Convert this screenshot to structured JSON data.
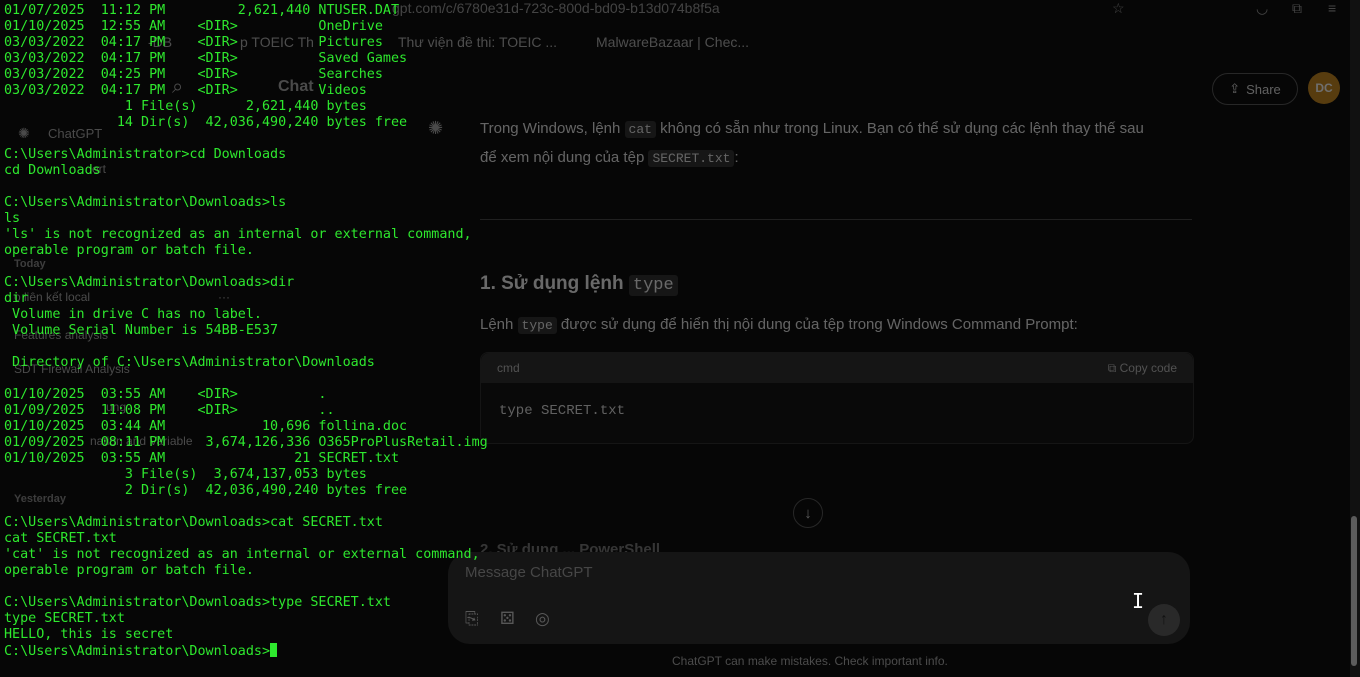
{
  "browser": {
    "url": "gpt.com/c/6780e31d-723c-800d-bd09-b13d074b8f5a",
    "bookmarks": [
      "-DB",
      "p TOEIC Th",
      "Thư viện đề thi: TOEIC ...",
      "MalwareBazaar | Chec..."
    ]
  },
  "sidebar": {
    "chatgpt_label": "ChatGPT",
    "explore_label": "ert",
    "today_heading": "Today",
    "today_items": [
      "o liên kết local",
      "Features analysis",
      "SDT Firewall Analysis",
      "ung",
      "nation and Variable"
    ],
    "yesterday_heading": "Yesterday"
  },
  "header": {
    "title": "Chat",
    "share_label": "Share",
    "avatar_initials": "DC"
  },
  "chat": {
    "intro_before": "Trong Windows, lệnh ",
    "intro_cmd": "cat",
    "intro_after": " không có sẵn như trong Linux. Bạn có thể sử dụng các lệnh thay thế sau",
    "intro_line2_before": "để xem nội dung của tệp ",
    "intro_file": "SECRET.txt",
    "intro_line2_after": ":",
    "heading_before": "1. Sử dụng lệnh ",
    "heading_cmd": "type",
    "desc_before": "Lệnh ",
    "desc_cmd": "type",
    "desc_after": " được sử dụng để hiển thị nội dung của tệp trong Windows Command Prompt:",
    "code_lang": "cmd",
    "copy_label": "Copy code",
    "code": "type SECRET.txt",
    "next_heading": "2. Sử dụng ... PowerShell"
  },
  "composer": {
    "placeholder": "Message ChatGPT",
    "disclaimer": "ChatGPT can make mistakes. Check important info."
  },
  "terminal": {
    "lines": [
      "01/07/2025  11:12 PM         2,621,440 NTUSER.DAT",
      "01/10/2025  12:55 AM    <DIR>          OneDrive",
      "03/03/2022  04:17 PM    <DIR>          Pictures",
      "03/03/2022  04:17 PM    <DIR>          Saved Games",
      "03/03/2022  04:25 PM    <DIR>          Searches",
      "03/03/2022  04:17 PM    <DIR>          Videos",
      "               1 File(s)      2,621,440 bytes",
      "              14 Dir(s)  42,036,490,240 bytes free",
      "",
      "C:\\Users\\Administrator>cd Downloads",
      "cd Downloads",
      "",
      "C:\\Users\\Administrator\\Downloads>ls",
      "ls",
      "'ls' is not recognized as an internal or external command,",
      "operable program or batch file.",
      "",
      "C:\\Users\\Administrator\\Downloads>dir",
      "dir",
      " Volume in drive C has no label.",
      " Volume Serial Number is 54BB-E537",
      "",
      " Directory of C:\\Users\\Administrator\\Downloads",
      "",
      "01/10/2025  03:55 AM    <DIR>          .",
      "01/09/2025  11:08 PM    <DIR>          ..",
      "01/10/2025  03:44 AM            10,696 follina.doc",
      "01/09/2025  08:11 PM     3,674,126,336 O365ProPlusRetail.img",
      "01/10/2025  03:55 AM                21 SECRET.txt",
      "               3 File(s)  3,674,137,053 bytes",
      "               2 Dir(s)  42,036,490,240 bytes free",
      "",
      "C:\\Users\\Administrator\\Downloads>cat SECRET.txt",
      "cat SECRET.txt",
      "'cat' is not recognized as an internal or external command,",
      "operable program or batch file.",
      "",
      "C:\\Users\\Administrator\\Downloads>type SECRET.txt",
      "type SECRET.txt",
      "HELLO, this is secret"
    ],
    "prompt": "C:\\Users\\Administrator\\Downloads>"
  }
}
